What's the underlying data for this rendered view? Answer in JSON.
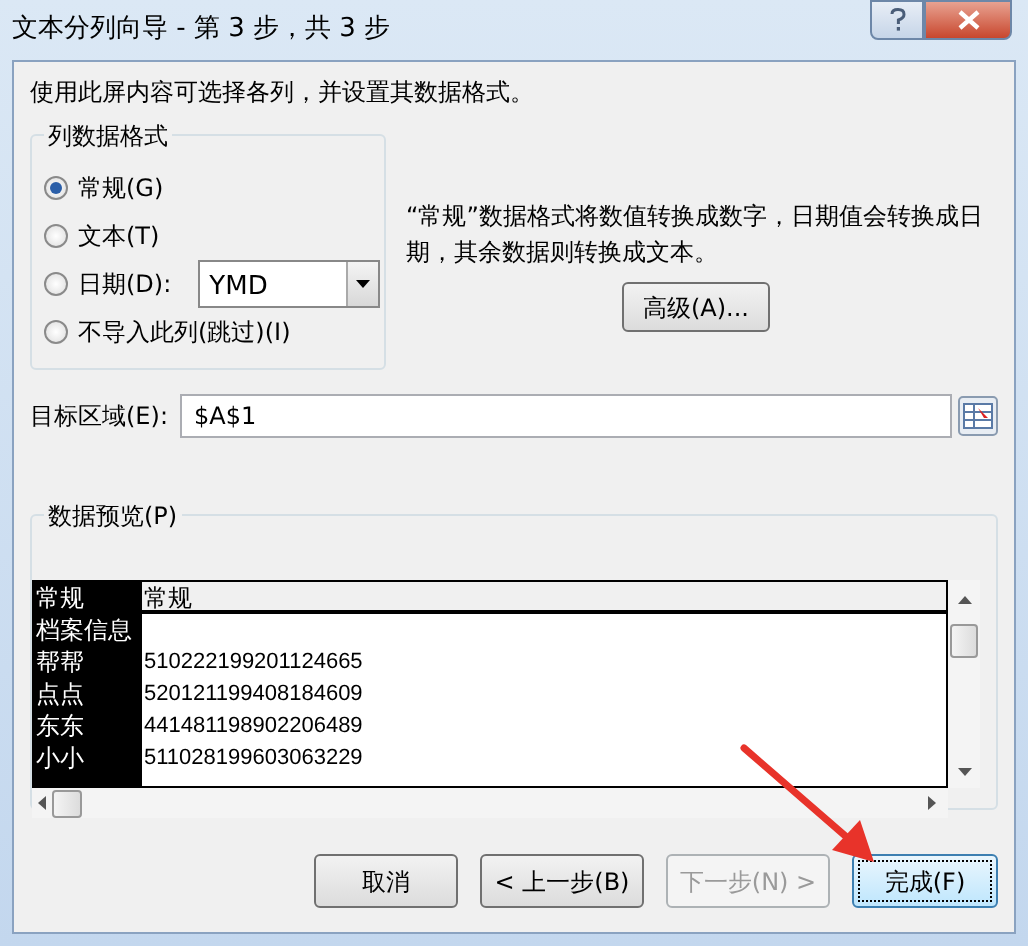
{
  "window": {
    "title": "文本分列向导 - 第 3 步，共 3 步"
  },
  "instructions": "使用此屏内容可选择各列，并设置其数据格式。",
  "column_format": {
    "title": "列数据格式",
    "options": [
      {
        "label": "常规(G)",
        "selected": true,
        "kind": "plain"
      },
      {
        "label": "文本(T)",
        "selected": false,
        "kind": "plain"
      },
      {
        "label": "日期(D):",
        "selected": false,
        "kind": "date"
      },
      {
        "label": "不导入此列(跳过)(I)",
        "selected": false,
        "kind": "plain"
      }
    ],
    "date_format": "YMD"
  },
  "description": "“常规”数据格式将数值转换成数字，日期值会转换成日期，其余数据则转换成文本。",
  "advanced_button": "高级(A)...",
  "destination": {
    "label": "目标区域(E):",
    "value": "$A$1"
  },
  "preview": {
    "title": "数据预览(P)",
    "columns": [
      {
        "header": "常规",
        "selected": true
      },
      {
        "header": "常规",
        "selected": false
      }
    ],
    "rows": [
      [
        "档案信息"
      ],
      [
        "帮帮",
        "510222199201124665"
      ],
      [
        "点点",
        "520121199408184609"
      ],
      [
        "东东",
        "441481198902206489"
      ],
      [
        "小小",
        "511028199603063229"
      ]
    ]
  },
  "buttons": [
    {
      "label": "取消",
      "disabled": false,
      "default": false
    },
    {
      "label": "< 上一步(B)",
      "disabled": false,
      "default": false
    },
    {
      "label": "下一步(N) >",
      "disabled": true,
      "default": false
    },
    {
      "label": "完成(F)",
      "disabled": false,
      "default": true
    }
  ]
}
